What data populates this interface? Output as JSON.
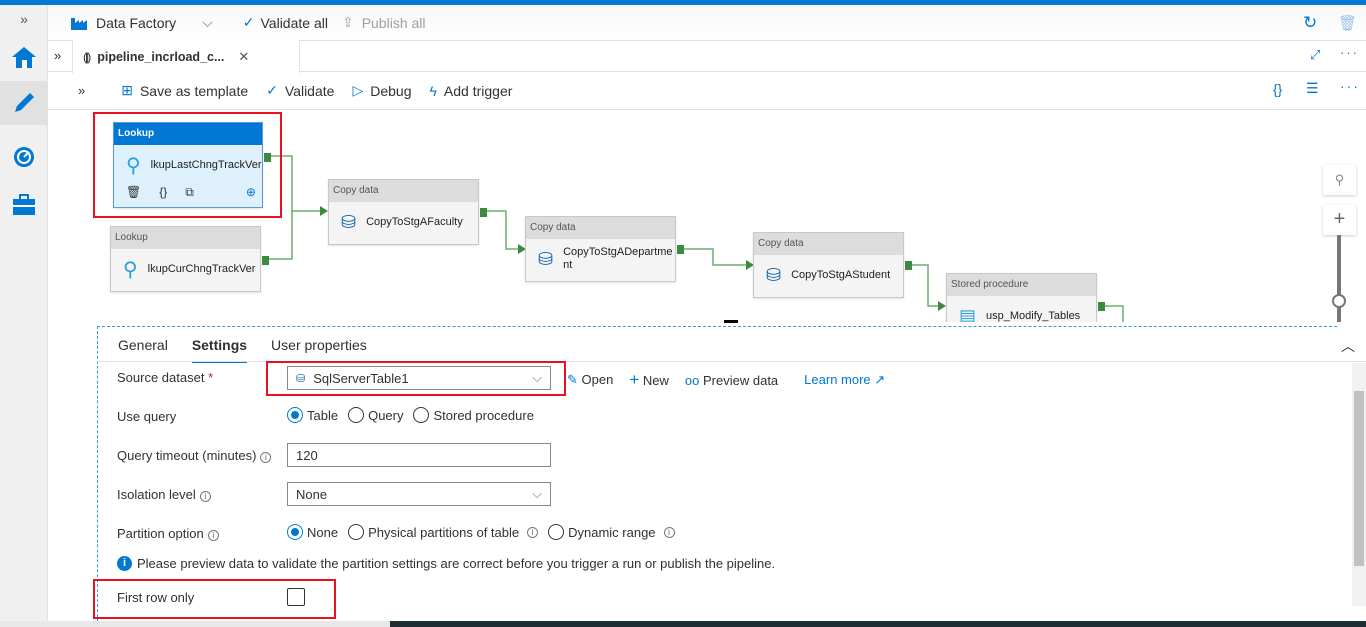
{
  "header": {
    "factory": "Data Factory",
    "validate_all": "Validate all",
    "publish_all": "Publish all"
  },
  "tab": {
    "title": "pipeline_incrload_c..."
  },
  "toolbar": {
    "save_template": "Save as template",
    "validate": "Validate",
    "debug": "Debug",
    "add_trigger": "Add trigger"
  },
  "nodes": [
    {
      "type": "Lookup",
      "name": "lkupLastChngTrackVer",
      "selected": true
    },
    {
      "type": "Lookup",
      "name": "lkupCurChngTrackVer"
    },
    {
      "type": "Copy data",
      "name": "CopyToStgAFaculty"
    },
    {
      "type": "Copy data",
      "name": "CopyToStgADepartme",
      "name2": "nt"
    },
    {
      "type": "Copy data",
      "name": "CopyToStgAStudent"
    },
    {
      "type": "Stored procedure",
      "name": "usp_Modify_Tables"
    }
  ],
  "panel": {
    "tabs": [
      "General",
      "Settings",
      "User properties"
    ],
    "active_tab": "Settings",
    "source_dataset": {
      "label": "Source dataset",
      "required": "*",
      "value": "SqlServerTable1",
      "open": "Open",
      "new": "New",
      "preview": "Preview data",
      "learn_more": "Learn more"
    },
    "use_query": {
      "label": "Use query",
      "options": [
        "Table",
        "Query",
        "Stored procedure"
      ],
      "selected": "Table"
    },
    "query_timeout": {
      "label": "Query timeout (minutes)",
      "value": "120"
    },
    "isolation": {
      "label": "Isolation level",
      "value": "None"
    },
    "partition": {
      "label": "Partition option",
      "options": [
        "None",
        "Physical partitions of table",
        "Dynamic range"
      ],
      "selected": "None"
    },
    "info_text": "Please preview data to validate the partition settings are correct before you trigger a run or publish the pipeline.",
    "first_row_only": {
      "label": "First row only",
      "checked": false
    }
  },
  "colors": {
    "accent": "#0078d4",
    "highlight": "#e81123",
    "success": "#3c8a40"
  }
}
